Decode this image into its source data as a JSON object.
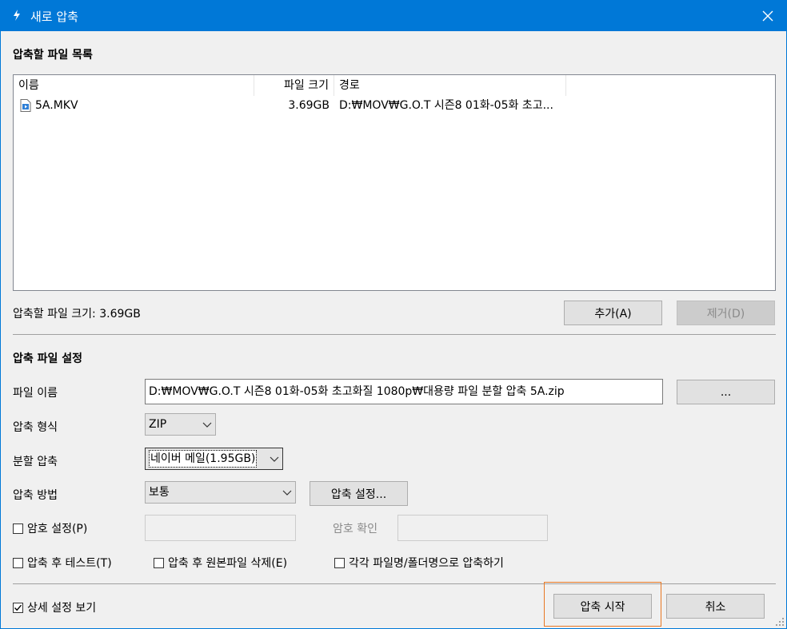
{
  "window": {
    "title": "새로 압축",
    "close_icon": "close-icon",
    "app_icon": "archive-app-icon"
  },
  "file_list": {
    "section_title": "압축할 파일 목록",
    "columns": [
      "이름",
      "파일 크기",
      "경로"
    ],
    "rows": [
      {
        "icon": "video-file-icon",
        "name": "5A.MKV",
        "size": "3.69GB",
        "path": "D:₩MOV₩G.O.T 시즌8 01화-05화 초고..."
      }
    ],
    "total_size": "압축할 파일 크기: 3.69GB",
    "add_button": "추가(A)",
    "remove_button": "제거(D)"
  },
  "settings": {
    "section_title": "압축 파일 설정",
    "filename_label": "파일 이름",
    "filename_value": "D:₩MOV₩G.O.T 시즌8 01화-05화 초고화질 1080p₩대용량 파일 분할 압축 5A.zip",
    "browse_button": "...",
    "format_label": "압축 형식",
    "format_value": "ZIP",
    "split_label": "분할 압축",
    "split_value": "네이버 메일(1.95GB)",
    "method_label": "압축 방법",
    "method_value": "보통",
    "method_settings_button": "압축 설정...",
    "password_label": "암호 설정(P)",
    "password_checked": false,
    "password_value": "",
    "password_confirm_label": "암호 확인",
    "password_confirm_value": "",
    "test_after_label": "압축 후 테스트(T)",
    "test_after_checked": false,
    "delete_original_label": "압축 후 원본파일 삭제(E)",
    "delete_original_checked": false,
    "each_separately_label": "각각 파일명/폴더명으로 압축하기",
    "each_separately_checked": false
  },
  "footer": {
    "show_details_label": "상세 설정 보기",
    "show_details_checked": true,
    "start_button": "압축 시작",
    "cancel_button": "취소",
    "highlight_color": "#e87722"
  }
}
